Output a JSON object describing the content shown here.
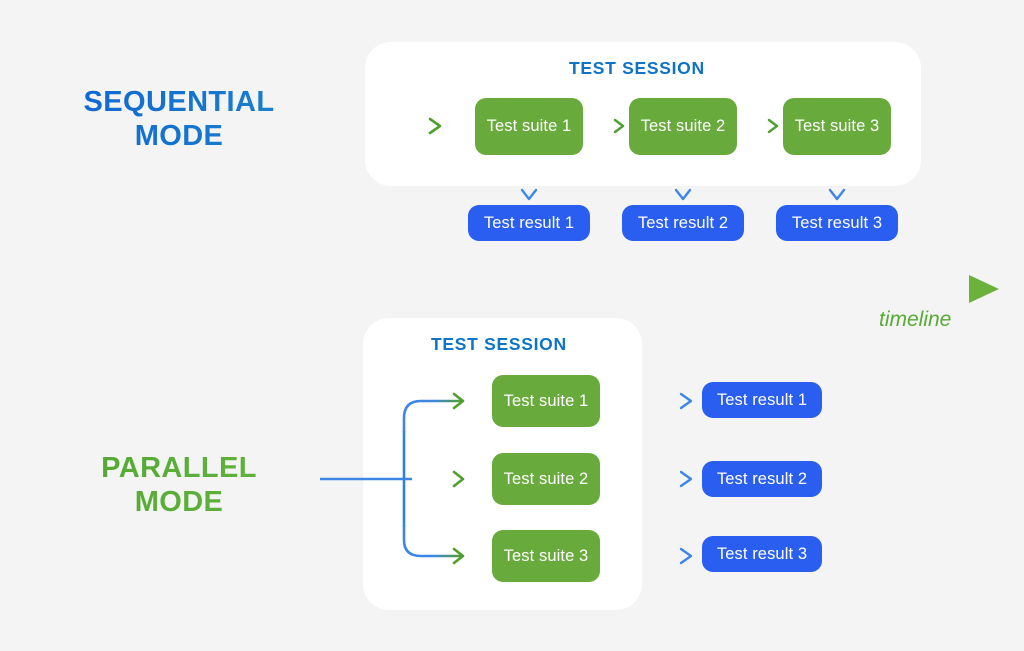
{
  "diagram": {
    "title_sequential": "SEQUENTIAL\nMODE",
    "title_parallel": "PARALLEL\nMODE",
    "timeline_label": "timeline"
  },
  "colors": {
    "background": "#f4f4f4",
    "card": "#ffffff",
    "suite_green": "#68ab3c",
    "result_blue": "#2a5ef0",
    "caption_blue": "#0e74c8",
    "label_blue": "#1168cc",
    "label_green": "#57ac34",
    "timeline_green": "#56ab33",
    "arrow_blue": "#3d86e8",
    "arrow_green": "#4f9f2f"
  },
  "sequential": {
    "mode_line1": "SEQUENTIAL",
    "mode_line2": "MODE",
    "session_caption": "TEST SESSION",
    "suites": [
      {
        "label": "Test suite 1"
      },
      {
        "label": "Test suite 2"
      },
      {
        "label": "Test suite 3"
      }
    ],
    "results": [
      {
        "label": "Test result 1"
      },
      {
        "label": "Test result 2"
      },
      {
        "label": "Test result 3"
      }
    ]
  },
  "parallel": {
    "mode_line1": "PARALLEL",
    "mode_line2": "MODE",
    "session_caption": "TEST SESSION",
    "suites": [
      {
        "label": "Test suite 1"
      },
      {
        "label": "Test suite 2"
      },
      {
        "label": "Test suite 3"
      }
    ],
    "results": [
      {
        "label": "Test result 1"
      },
      {
        "label": "Test result 2"
      },
      {
        "label": "Test result 3"
      }
    ]
  },
  "timeline": {
    "label": "timeline"
  }
}
